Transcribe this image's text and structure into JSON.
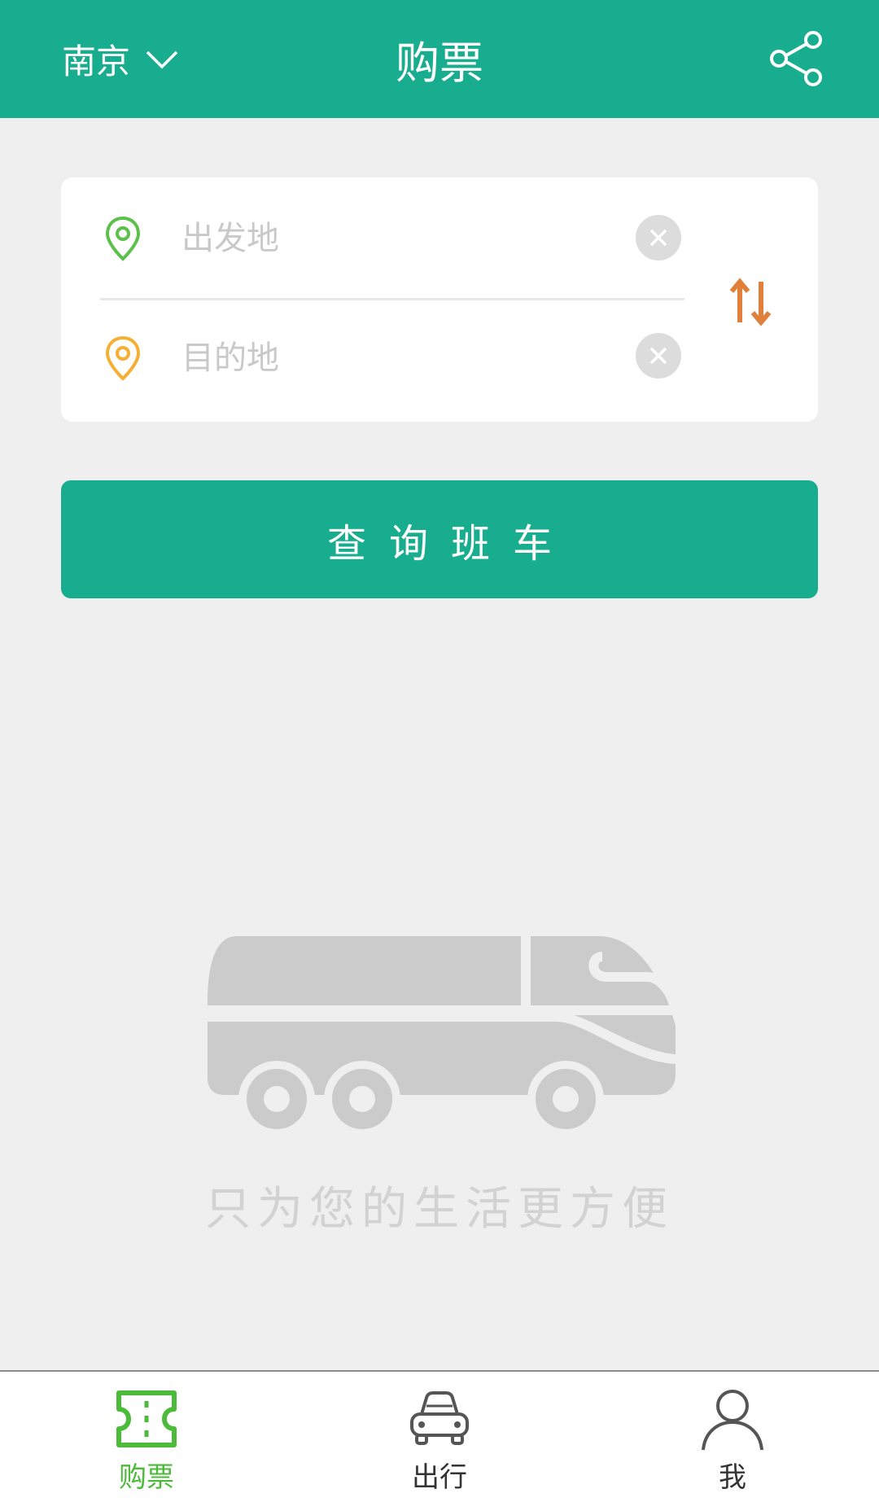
{
  "header": {
    "city": "南京",
    "title": "购票",
    "city_icon": "chevron-down-icon",
    "share_icon": "share-icon"
  },
  "search": {
    "from_placeholder": "出发地",
    "from_value": "",
    "to_placeholder": "目的地",
    "to_value": "",
    "from_icon": "location-pin-icon",
    "to_icon": "location-pin-icon",
    "clear_icon": "clear-icon",
    "swap_icon": "swap-icon"
  },
  "query_button": "查询班车",
  "empty_state": {
    "illustration": "bus-icon",
    "slogan": "只为您的生活更方便"
  },
  "tabs": [
    {
      "label": "购票",
      "icon": "ticket-icon",
      "active": true
    },
    {
      "label": "出行",
      "icon": "car-icon",
      "active": false
    },
    {
      "label": "我",
      "icon": "user-icon",
      "active": false
    }
  ],
  "colors": {
    "primary": "#19ad8f",
    "from_pin": "#5cc04a",
    "to_pin": "#f5b034",
    "swap": "#e0803a",
    "active_tab": "#4cbb3a",
    "placeholder": "#c9c9c9"
  }
}
